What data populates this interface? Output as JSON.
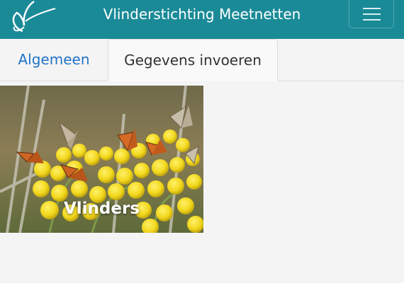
{
  "header": {
    "title": "Vlinderstichting Meetnetten",
    "logo_icon": "butterfly-logo-icon",
    "menu_icon": "hamburger-menu-icon",
    "background_color": "#1a8a97"
  },
  "tabs": [
    {
      "label": "Algemeen",
      "active": false
    },
    {
      "label": "Gegevens invoeren",
      "active": true
    }
  ],
  "cards": [
    {
      "label": "Vlinders",
      "image": "butterflies-on-yellow-flowers"
    }
  ]
}
